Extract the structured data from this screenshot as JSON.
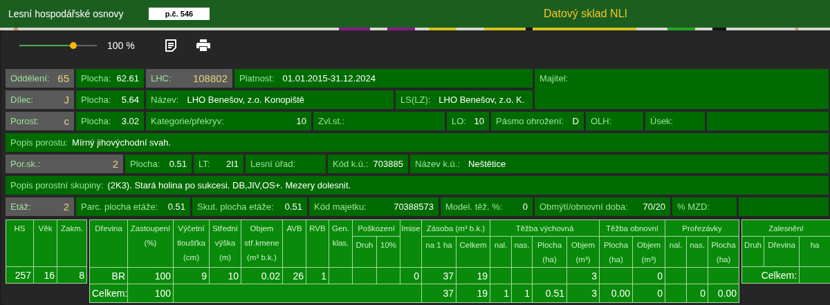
{
  "header": {
    "title": "Lesní hospodářské osnovy",
    "badge": "p.č. 546",
    "app_name": "Datový sklad NLI"
  },
  "toolbar": {
    "zoom_slider": {
      "level": 0.7
    },
    "zoom_value": "100 %"
  },
  "info_rows": [
    [
      {
        "kind": "key",
        "label": "Oddělení:",
        "value": "65"
      },
      {
        "kind": "field",
        "label": "Plocha:",
        "value": "62.61"
      },
      {
        "kind": "key",
        "label": "LHC:",
        "value": "108802"
      },
      {
        "kind": "text",
        "label": "Platnost:",
        "value": "01.01.2015-31.12.2024"
      },
      {
        "kind": "text",
        "label": "Majitel:"
      }
    ],
    [
      {
        "kind": "key",
        "label": "Dílec:",
        "value": "J"
      },
      {
        "kind": "field",
        "label": "Plocha:",
        "value": "5.64"
      },
      {
        "kind": "text",
        "label": "Název:",
        "value": "LHO Benešov, z.o. Konopiště"
      },
      {
        "kind": "text",
        "label": "LS(LZ):",
        "value": "LHO Benešov, z.o. K."
      }
    ],
    [
      {
        "kind": "key",
        "label": "Porost:",
        "value": "c"
      },
      {
        "kind": "field",
        "label": "Plocha:",
        "value": "3.02"
      },
      {
        "kind": "field",
        "label": "Kategorie/překryv:",
        "value": "10"
      },
      {
        "kind": "field",
        "label": "Zvl.st.:"
      },
      {
        "kind": "field",
        "label": "LO:",
        "value": "10"
      },
      {
        "kind": "field",
        "label": "Pásmo ohrožení:",
        "value": "D"
      },
      {
        "kind": "field",
        "label": "OLH:"
      },
      {
        "kind": "field",
        "label": "Úsek:"
      },
      {
        "kind": "empty"
      }
    ],
    [
      {
        "kind": "text",
        "label": "Popis porostu:",
        "value": "Mírný jihovýchodní svah."
      }
    ],
    [
      {
        "kind": "key",
        "label": "Por.sk.:",
        "value": "2"
      },
      {
        "kind": "field",
        "label": "Plocha:",
        "value": "0.51"
      },
      {
        "kind": "field",
        "label": "LT:",
        "value": "2I1"
      },
      {
        "kind": "field",
        "label": "Lesní úřad:"
      },
      {
        "kind": "field",
        "label": "Kód k.ú.:",
        "value": "703885"
      },
      {
        "kind": "text",
        "label": "Název k.ú.:",
        "value": "Neštětice"
      }
    ],
    [
      {
        "kind": "text",
        "label": "Popis porostní skupiny:",
        "value": "(2K3). Stará holina po sukcesi. DB,JIV,OS+. Mezery dolesnit."
      }
    ],
    [
      {
        "kind": "key",
        "label": "Etáž:",
        "value": "2"
      },
      {
        "kind": "field",
        "label": "Parc. plocha etáže:",
        "value": "0.51"
      },
      {
        "kind": "field",
        "label": "Skut. plocha etáže:",
        "value": "0.51"
      },
      {
        "kind": "field",
        "label": "Kód majetku:",
        "value": "70388573"
      },
      {
        "kind": "field",
        "label": "Model. těž. %:",
        "value": "0"
      },
      {
        "kind": "field",
        "label": "Obmýtí/obnovní doba:",
        "value": "70/20"
      },
      {
        "kind": "field",
        "label": "% MZD:"
      },
      {
        "kind": "empty"
      }
    ]
  ],
  "stand_table": {
    "columns": [
      "HS",
      "Věk",
      "Zakm."
    ],
    "rows": [
      [
        "257",
        "16",
        "8"
      ]
    ]
  },
  "species_table": {
    "header": [
      {
        "label": "Dřevina"
      },
      {
        "label": "Zastoupení\n(%)"
      },
      {
        "label": "Výčetní\ntloušťka\n(cm)"
      },
      {
        "label": "Střední\nvýška\n(m)"
      },
      {
        "label": "Objem\nstř.kmene\n(m³ b.k.)"
      },
      {
        "label": "AVB"
      },
      {
        "label": "RVB"
      },
      {
        "label": "Gen.\nklas."
      },
      {
        "label": "Poškození",
        "columns": [
          "Druh",
          "10%"
        ]
      },
      {
        "label": "Imise"
      },
      {
        "label": "Zásoba (m³ b.k.)",
        "columns": [
          "na 1 ha",
          "Celkem"
        ]
      },
      {
        "label": "Těžba výchovná",
        "columns": [
          "nal.",
          "nas.",
          "Plocha\n(ha)",
          "Objem\n(m³)"
        ]
      },
      {
        "label": "Těžba obnovní",
        "columns": [
          "Plocha\n(ha)",
          "Objem\n(m³)"
        ]
      },
      {
        "label": "Prořezávky",
        "columns": [
          "nal.",
          "nas.",
          "Plocha\n(ha)"
        ]
      }
    ],
    "rows": [
      [
        {
          "kind": "value",
          "text": "BR"
        },
        {
          "kind": "value",
          "text": "100"
        },
        {
          "kind": "value",
          "text": "9"
        },
        {
          "kind": "value",
          "text": "10"
        },
        {
          "kind": "value",
          "text": "0.02"
        },
        {
          "kind": "value",
          "text": "26"
        },
        {
          "kind": "value",
          "text": "1"
        },
        {
          "kind": "empty"
        },
        {
          "kind": "empty"
        },
        {
          "kind": "empty"
        },
        {
          "kind": "value",
          "text": "0"
        },
        {
          "kind": "value",
          "text": "37"
        },
        {
          "kind": "value",
          "text": "19"
        },
        {
          "kind": "empty"
        },
        {
          "kind": "empty"
        },
        {
          "kind": "empty"
        },
        {
          "kind": "value",
          "text": "3"
        },
        {
          "kind": "empty"
        },
        {
          "kind": "value",
          "text": "0"
        },
        {
          "kind": "empty"
        },
        {
          "kind": "empty"
        },
        {
          "kind": "empty"
        }
      ]
    ],
    "total": [
      {
        "kind": "value",
        "text": "Celkem:"
      },
      {
        "kind": "value",
        "text": "100"
      },
      {
        "kind": "empty"
      },
      {
        "kind": "value",
        "text": "37"
      },
      {
        "kind": "value",
        "text": "19"
      },
      {
        "kind": "value",
        "text": "1"
      },
      {
        "kind": "value",
        "text": "1"
      },
      {
        "kind": "value",
        "text": "0.51"
      },
      {
        "kind": "value",
        "text": "3"
      },
      {
        "kind": "value",
        "text": "0.00"
      },
      {
        "kind": "value",
        "text": "0"
      },
      {
        "kind": "empty"
      },
      {
        "kind": "value",
        "text": "0"
      },
      {
        "kind": "value",
        "text": "0.00"
      }
    ]
  },
  "afforestation_table": {
    "title": "Zalesnění",
    "columns": [
      "Druh",
      "Dřevina",
      "ha"
    ],
    "total_label": "Celkem:"
  }
}
